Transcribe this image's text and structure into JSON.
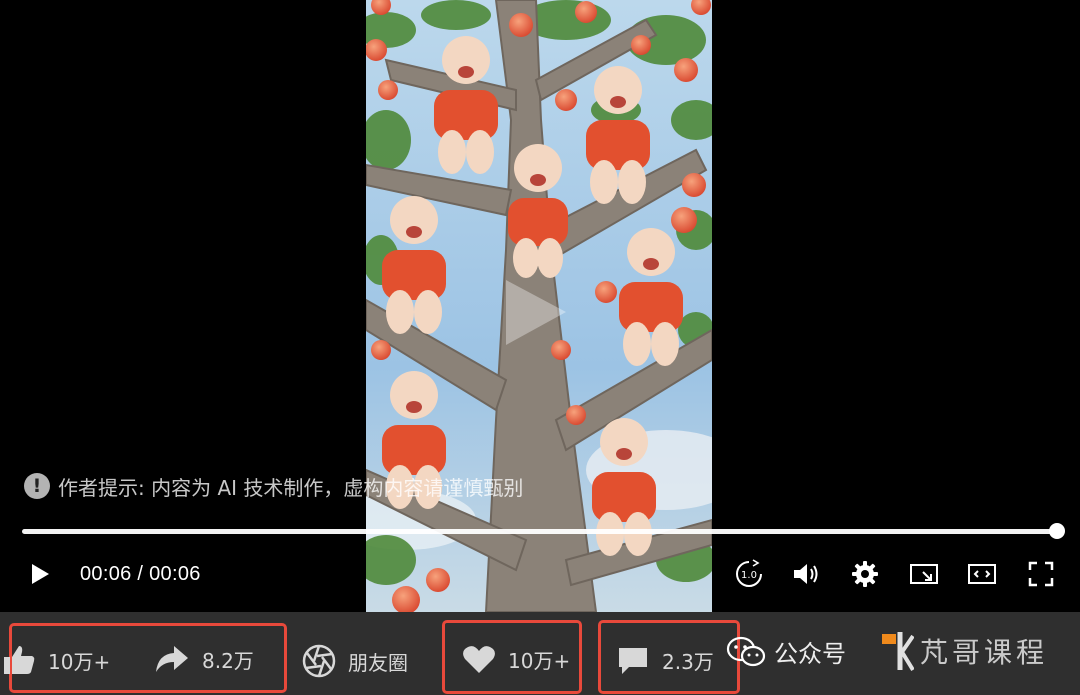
{
  "notice": {
    "icon": "exclamation-circle-icon",
    "text": "作者提示: 内容为 AI 技术制作，虚构内容请谨慎甄别"
  },
  "player": {
    "progress": 1.0,
    "time_display": "00:06 / 00:06",
    "speed_label": "1.0",
    "controls": [
      "play-icon",
      "replay-speed-icon",
      "volume-icon",
      "gear-icon",
      "cast-icon",
      "fullscreen-web-icon",
      "fullscreen-icon"
    ]
  },
  "actions": {
    "like_count": "10万+",
    "share_count": "8.2万",
    "moments_label": "朋友圈",
    "favorite_count": "10万+",
    "comment_count": "2.3万"
  },
  "watermark": {
    "wechat_label": "公众号",
    "brand_text": "芃哥课程"
  },
  "colors": {
    "highlight_border": "#e8493b",
    "bar_bg": "#2f2f2f",
    "text": "#d8d8d8"
  }
}
